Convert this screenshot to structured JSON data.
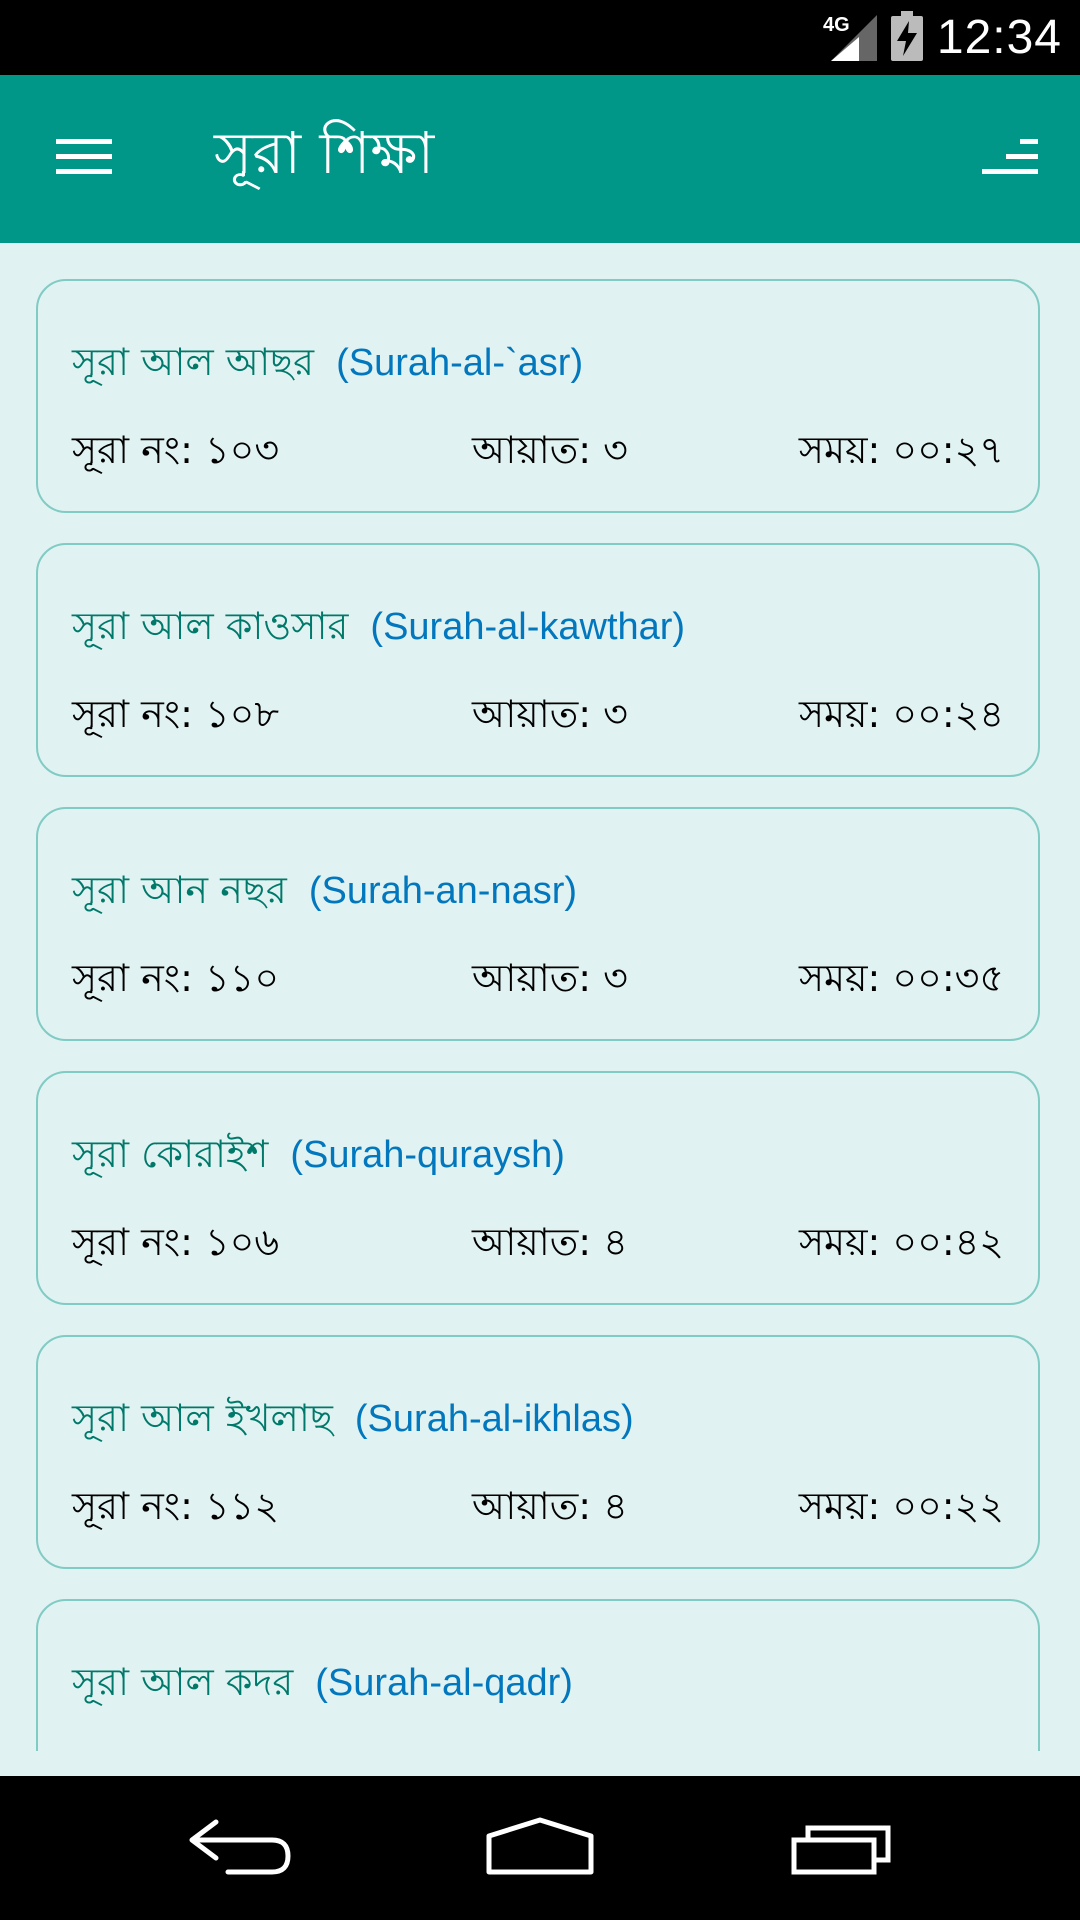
{
  "status_bar": {
    "network": "4G",
    "time": "12:34",
    "icons": [
      "signal-icon",
      "battery-charging-icon"
    ]
  },
  "app_bar": {
    "title": "সূরা শিক্ষা",
    "menu_icon": "hamburger-menu-icon",
    "sort_icon": "sort-icon"
  },
  "surahs": [
    {
      "bn_name": "সূরা আল আছর",
      "en_name": "(Surah-al-`asr)",
      "number": "সূরা নং: ১০৩",
      "ayat": "আয়াত: ৩",
      "time": "সময়: ০০:২৭"
    },
    {
      "bn_name": "সূরা আল কাওসার",
      "en_name": "(Surah-al-kawthar)",
      "number": "সূরা নং: ১০৮",
      "ayat": "আয়াত: ৩",
      "time": "সময়: ০০:২৪"
    },
    {
      "bn_name": "সূরা আন নছর",
      "en_name": "(Surah-an-nasr)",
      "number": "সূরা নং: ১১০",
      "ayat": "আয়াত: ৩",
      "time": "সময়: ০০:৩৫"
    },
    {
      "bn_name": "সূরা কোরাইশ",
      "en_name": "(Surah-quraysh)",
      "number": "সূরা নং: ১০৬",
      "ayat": "আয়াত: ৪",
      "time": "সময়: ০০:৪২"
    },
    {
      "bn_name": "সূরা আল ইখলাছ",
      "en_name": "(Surah-al-ikhlas)",
      "number": "সূরা নং: ১১২",
      "ayat": "আয়াত: ৪",
      "time": "সময়: ০০:২২"
    },
    {
      "bn_name": "সূরা আল কদর",
      "en_name": "(Surah-al-qadr)",
      "number": "",
      "ayat": "",
      "time": ""
    }
  ],
  "colors": {
    "primary": "#009688",
    "background": "#e0f2f1",
    "card_border": "#80cbc4",
    "bn_name": "#00796b",
    "en_name": "#0277bd"
  },
  "nav_bar": {
    "icons": [
      "back-icon",
      "home-icon",
      "recent-apps-icon"
    ]
  }
}
